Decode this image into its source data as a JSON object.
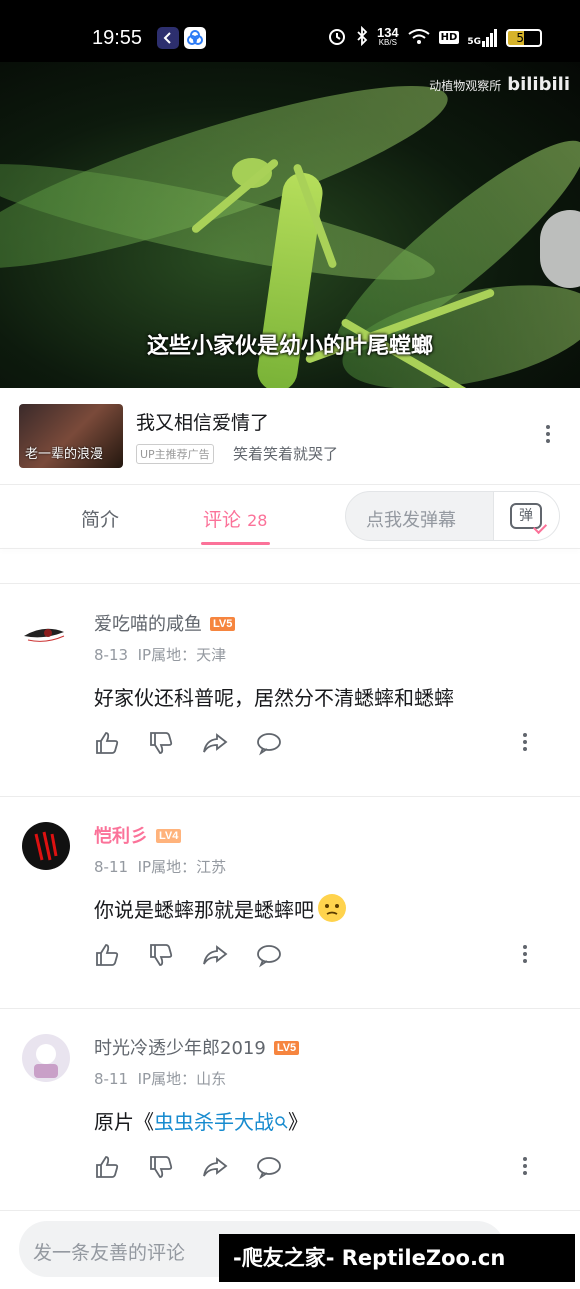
{
  "status_bar": {
    "time": "19:55",
    "net_speed_value": "134",
    "net_speed_unit": "KB/S",
    "hd": "HD",
    "signal": "5G",
    "battery": "50"
  },
  "video": {
    "watermark_text": "动植物观察所",
    "watermark_logo": "bilibili",
    "subtitle": "这些小家伙是幼小的叶尾螳螂",
    "progress_fraction": 0.44
  },
  "ad": {
    "thumb_caption": "老一辈的浪漫",
    "title": "我又相信爱情了",
    "tag": "UP主推荐广告",
    "subtitle": "笑着笑着就哭了"
  },
  "tabs": {
    "intro": "简介",
    "comments": "评论",
    "comment_count": "28",
    "danmaku_placeholder": "点我发弹幕",
    "danmaku_icon_text": "弹"
  },
  "comments": [
    {
      "username": "爱吃喵的咸鱼",
      "level": "LV5",
      "level_color": "#f6853f",
      "date": "8-13",
      "ip": "IP属地：天津",
      "text": "好家伙还科普呢，居然分不清蟋蟀和蟋蟀"
    },
    {
      "username": "恺利彡",
      "level": "LV4",
      "level_color": "#ffb37c",
      "date": "8-11",
      "ip": "IP属地：江苏",
      "text": "你说是蟋蟀那就是蟋蟀吧"
    },
    {
      "username": "时光冷透少年郎2019",
      "level": "LV5",
      "level_color": "#f6853f",
      "date": "8-11",
      "ip": "IP属地：山东",
      "text_prefix": "原片《",
      "text_link": "虫虫杀手大战",
      "text_suffix": "》"
    }
  ],
  "bottom": {
    "input_placeholder": "发一条友善的评论"
  },
  "site_watermark": "-爬友之家- ReptileZoo.cn"
}
